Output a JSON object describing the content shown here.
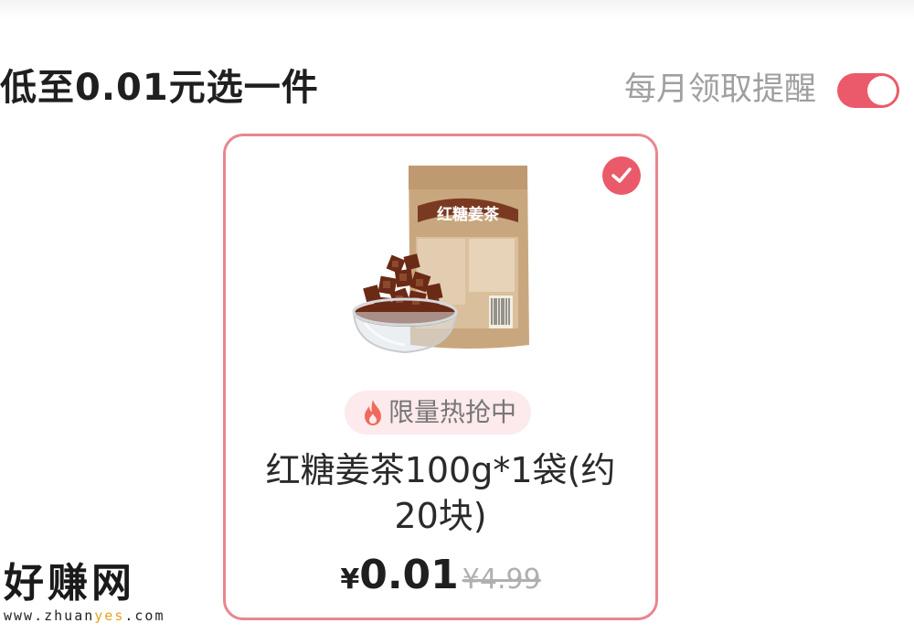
{
  "section": {
    "title": "低至0.01元选一件",
    "reminder_label": "每月领取提醒",
    "reminder_enabled": true
  },
  "product": {
    "package_label": "红糖姜茶",
    "badge_text": "限量热抢中",
    "name": "红糖姜茶100g*1袋(约20块)",
    "price_symbol": "¥",
    "price": "0.01",
    "original_price": "¥4.99",
    "selected": true
  },
  "watermark": {
    "logo": "好赚网",
    "url_prefix": "www.zhuan",
    "url_highlight": "yes",
    "url_suffix": ".com"
  },
  "colors": {
    "accent": "#eb5a6a",
    "card_border": "#e8868f",
    "badge_bg": "#fdeaec"
  },
  "icons": {
    "check": "check-icon",
    "fire": "fire-icon"
  }
}
